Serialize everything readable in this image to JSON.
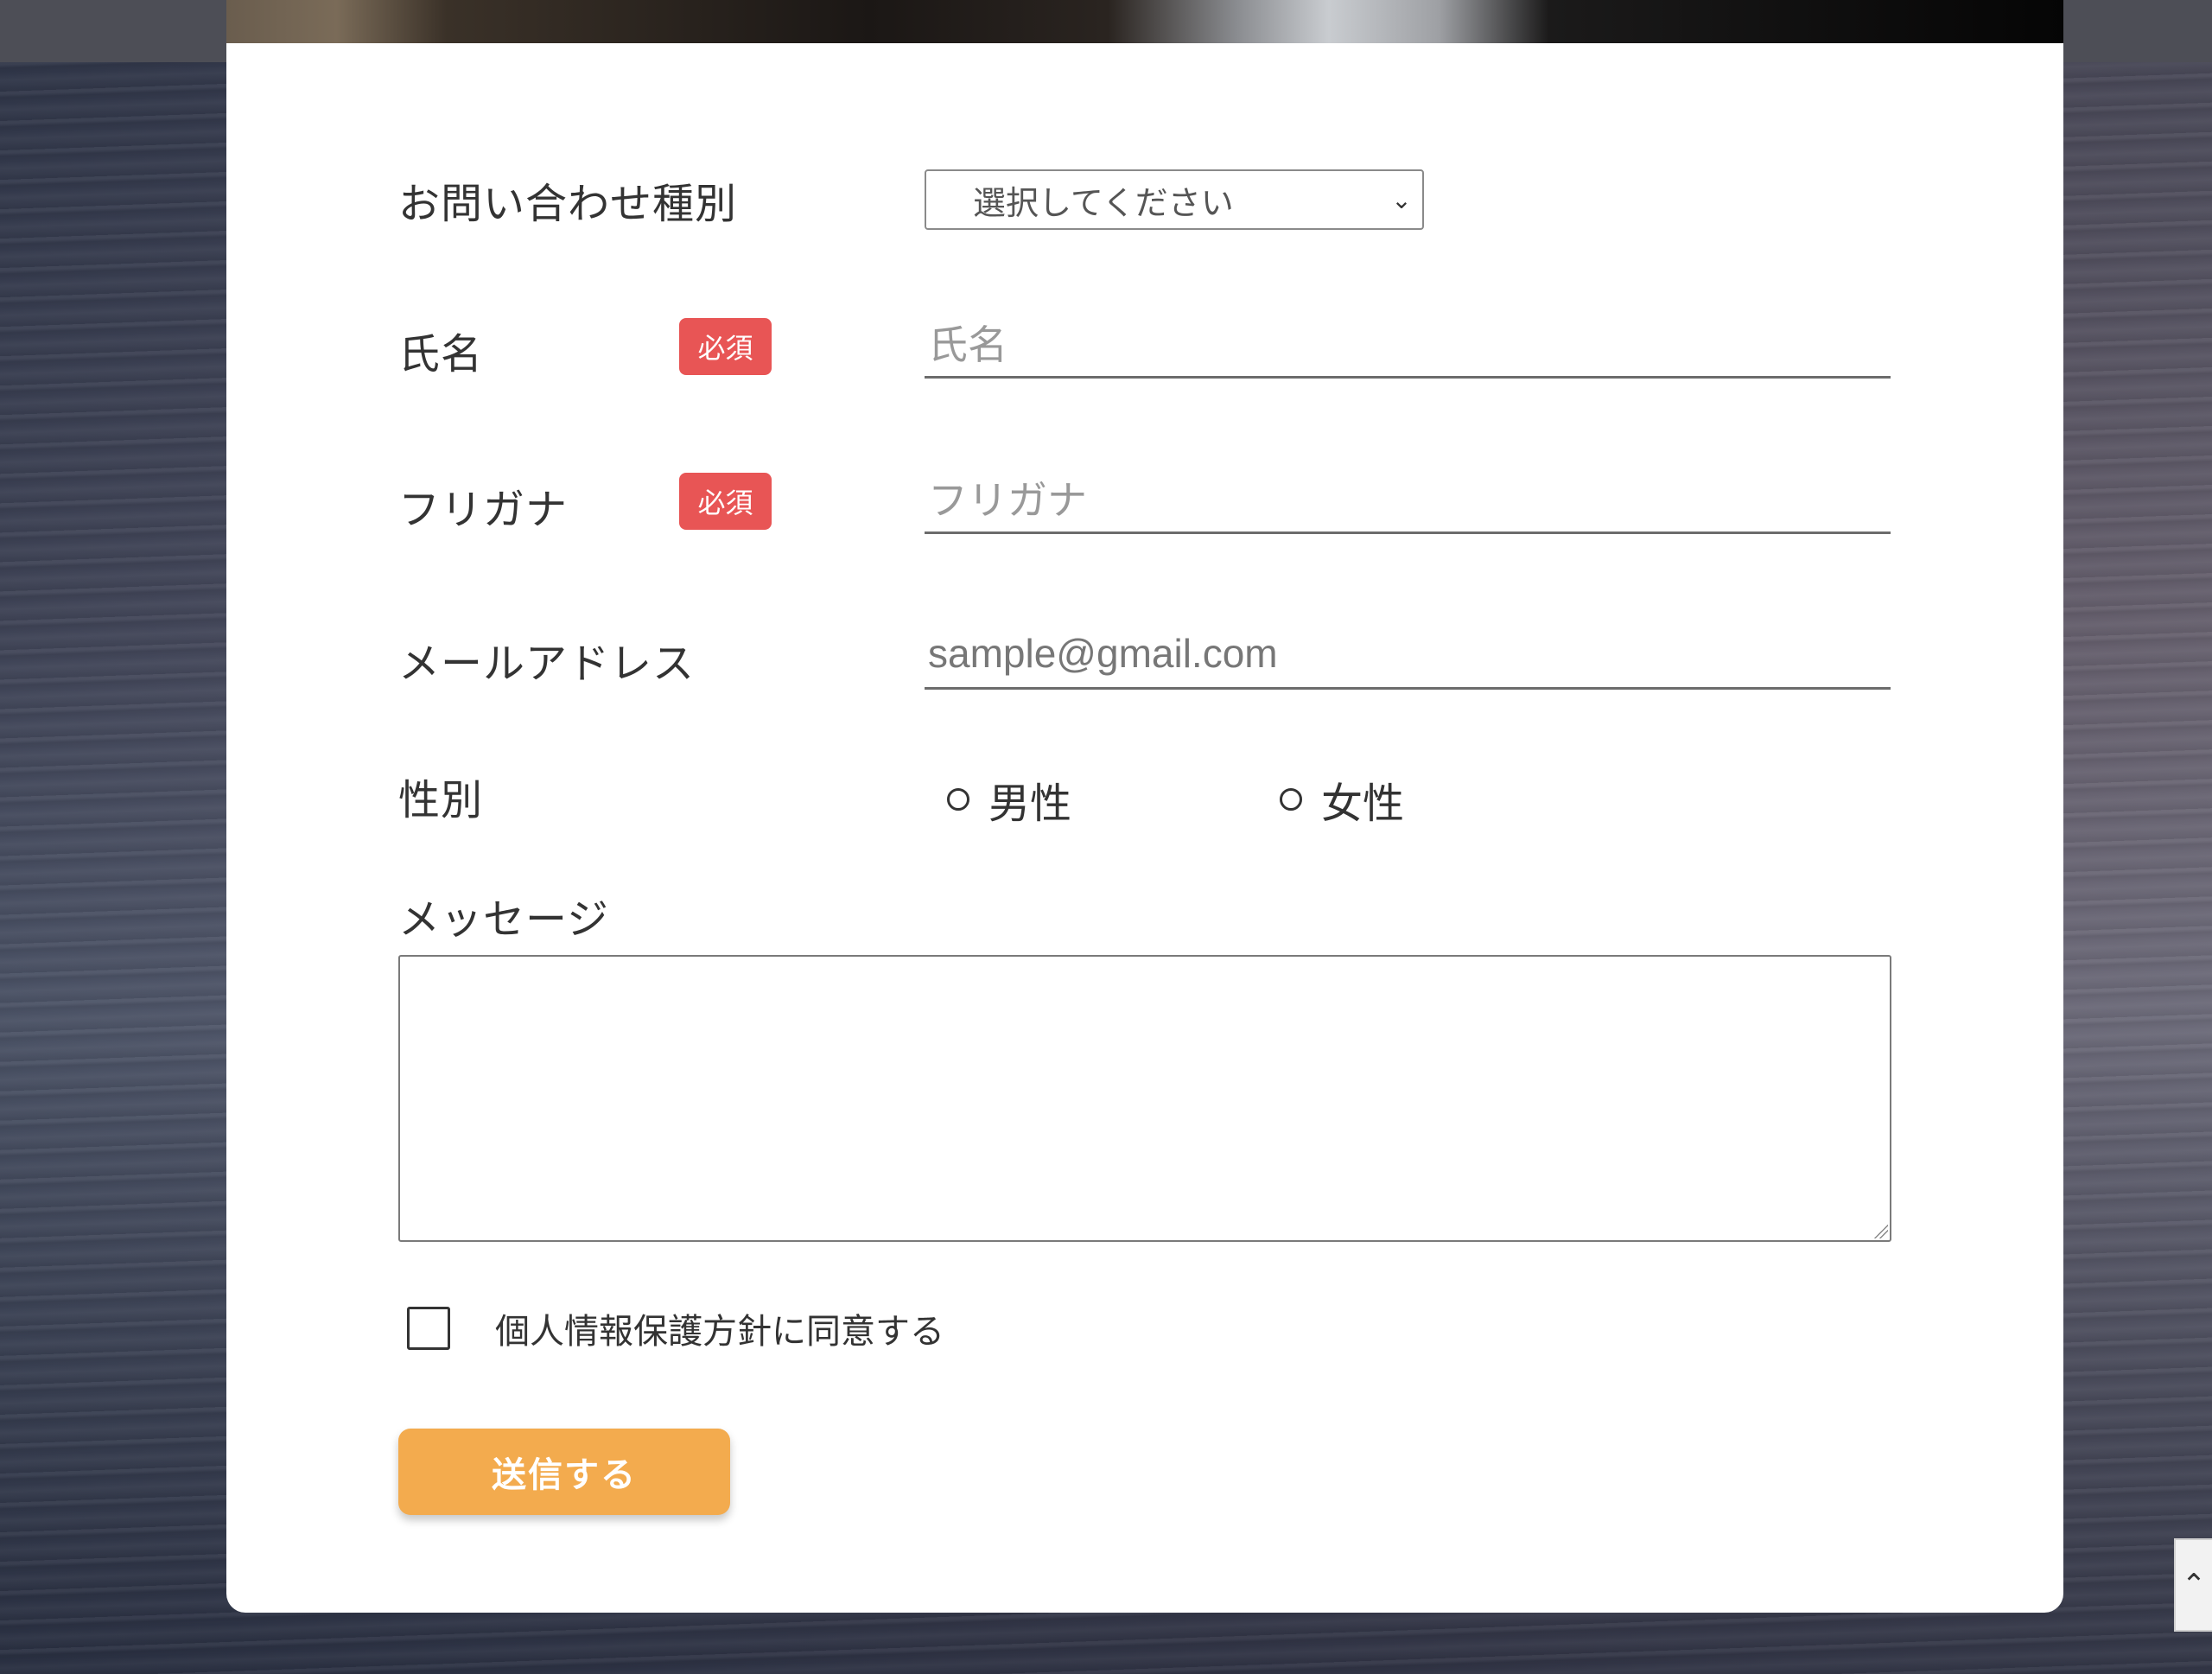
{
  "form": {
    "inquiry_type": {
      "label": "お問い合わせ種別",
      "selected": "選択してください"
    },
    "name": {
      "label": "氏名",
      "required_badge": "必須",
      "placeholder": "氏名"
    },
    "furigana": {
      "label": "フリガナ",
      "required_badge": "必須",
      "placeholder": "フリガナ"
    },
    "email": {
      "label": "メールアドレス",
      "placeholder": "sample@gmail.com"
    },
    "gender": {
      "label": "性別",
      "options": [
        "男性",
        "女性"
      ]
    },
    "message": {
      "label": "メッセージ"
    },
    "privacy_consent": {
      "label": "個人情報保護方針に同意する"
    },
    "submit_label": "送信する"
  },
  "icons": {
    "select_chevron": "chevron-down-icon",
    "page_top": "chevron-up-icon"
  },
  "colors": {
    "required_badge": "#e85555",
    "submit_button": "#f3ab4e",
    "card_background": "#ffffff"
  }
}
